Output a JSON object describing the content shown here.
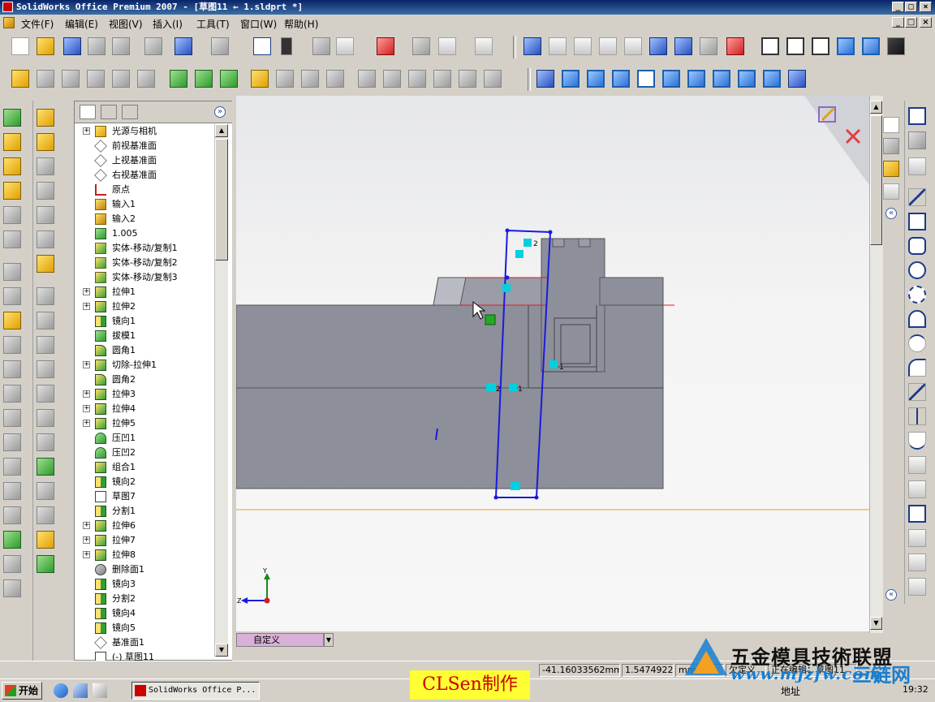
{
  "window": {
    "title": "SolidWorks Office Premium 2007 - [草图11 ← 1.sldprt *]"
  },
  "menu": [
    "文件(F)",
    "编辑(E)",
    "视图(V)",
    "插入(I)",
    "工具(T)",
    "窗口(W)",
    "帮助(H)"
  ],
  "tree": {
    "items": [
      {
        "label": "光源与相机",
        "expand": true,
        "icon": "lights-cameras-icon"
      },
      {
        "label": "前视基准面",
        "expand": false,
        "icon": "plane-icon"
      },
      {
        "label": "上视基准面",
        "expand": false,
        "icon": "plane-icon"
      },
      {
        "label": "右视基准面",
        "expand": false,
        "icon": "plane-icon"
      },
      {
        "label": "原点",
        "expand": false,
        "icon": "origin-icon"
      },
      {
        "label": "输入1",
        "expand": false,
        "icon": "import-icon"
      },
      {
        "label": "输入2",
        "expand": false,
        "icon": "import-icon"
      },
      {
        "label": "1.005",
        "expand": false,
        "icon": "feature-icon"
      },
      {
        "label": "实体-移动/复制1",
        "expand": false,
        "icon": "move-copy-icon"
      },
      {
        "label": "实体-移动/复制2",
        "expand": false,
        "icon": "move-copy-icon"
      },
      {
        "label": "实体-移动/复制3",
        "expand": false,
        "icon": "move-copy-icon"
      },
      {
        "label": "拉伸1",
        "expand": true,
        "icon": "extrude-icon"
      },
      {
        "label": "拉伸2",
        "expand": true,
        "icon": "extrude-icon"
      },
      {
        "label": "镜向1",
        "expand": false,
        "icon": "mirror-icon"
      },
      {
        "label": "拔模1",
        "expand": false,
        "icon": "draft-icon"
      },
      {
        "label": "圆角1",
        "expand": false,
        "icon": "fillet-icon"
      },
      {
        "label": "切除-拉伸1",
        "expand": true,
        "icon": "cut-extrude-icon"
      },
      {
        "label": "圆角2",
        "expand": false,
        "icon": "fillet-icon"
      },
      {
        "label": "拉伸3",
        "expand": true,
        "icon": "extrude-icon"
      },
      {
        "label": "拉伸4",
        "expand": true,
        "icon": "extrude-icon"
      },
      {
        "label": "拉伸5",
        "expand": true,
        "icon": "extrude-icon"
      },
      {
        "label": "压凹1",
        "expand": false,
        "icon": "indent-icon"
      },
      {
        "label": "压凹2",
        "expand": false,
        "icon": "indent-icon"
      },
      {
        "label": "组合1",
        "expand": false,
        "icon": "combine-icon"
      },
      {
        "label": "镜向2",
        "expand": false,
        "icon": "mirror-icon"
      },
      {
        "label": "草图7",
        "expand": false,
        "icon": "sketch-icon"
      },
      {
        "label": "分割1",
        "expand": false,
        "icon": "split-icon"
      },
      {
        "label": "拉伸6",
        "expand": true,
        "icon": "extrude-icon"
      },
      {
        "label": "拉伸7",
        "expand": true,
        "icon": "extrude-icon"
      },
      {
        "label": "拉伸8",
        "expand": true,
        "icon": "extrude-icon"
      },
      {
        "label": "删除面1",
        "expand": false,
        "icon": "delete-face-icon"
      },
      {
        "label": "镜向3",
        "expand": false,
        "icon": "mirror-icon"
      },
      {
        "label": "分割2",
        "expand": false,
        "icon": "split-icon"
      },
      {
        "label": "镜向4",
        "expand": false,
        "icon": "mirror-icon"
      },
      {
        "label": "镜向5",
        "expand": false,
        "icon": "mirror-icon"
      },
      {
        "label": "基准面1",
        "expand": false,
        "icon": "plane-icon"
      },
      {
        "label": "(-) 草图11",
        "expand": false,
        "icon": "sketch-icon"
      }
    ]
  },
  "viewport": {
    "triad": {
      "x": "Z",
      "y": "Y"
    },
    "relation_labels": {
      "r1": "2",
      "r2": "1",
      "r3": "2",
      "r4": "1"
    },
    "orientation_label": "自定义"
  },
  "status": {
    "x": "-41.16033562mm",
    "y": "1.5474922",
    "unit": "mm",
    "state": "欠定义",
    "editing": "正在编辑：草图11"
  },
  "taskbar": {
    "start": "开始",
    "task": "SolidWorks Office P...",
    "address": "地址",
    "clock": "19:32"
  },
  "overlay": {
    "credit": "CLSen制作",
    "watermark_cn": "五金模具技術联盟",
    "watermark_url": "www.mjzfw.com",
    "watermark_mark": "三链网"
  },
  "colors": {
    "sketch": "#1a1adf",
    "relation": "#00d0e0",
    "part": "#8d8f9a",
    "highlight_edge": "#e02020",
    "watermark": "#1a7fd0"
  }
}
